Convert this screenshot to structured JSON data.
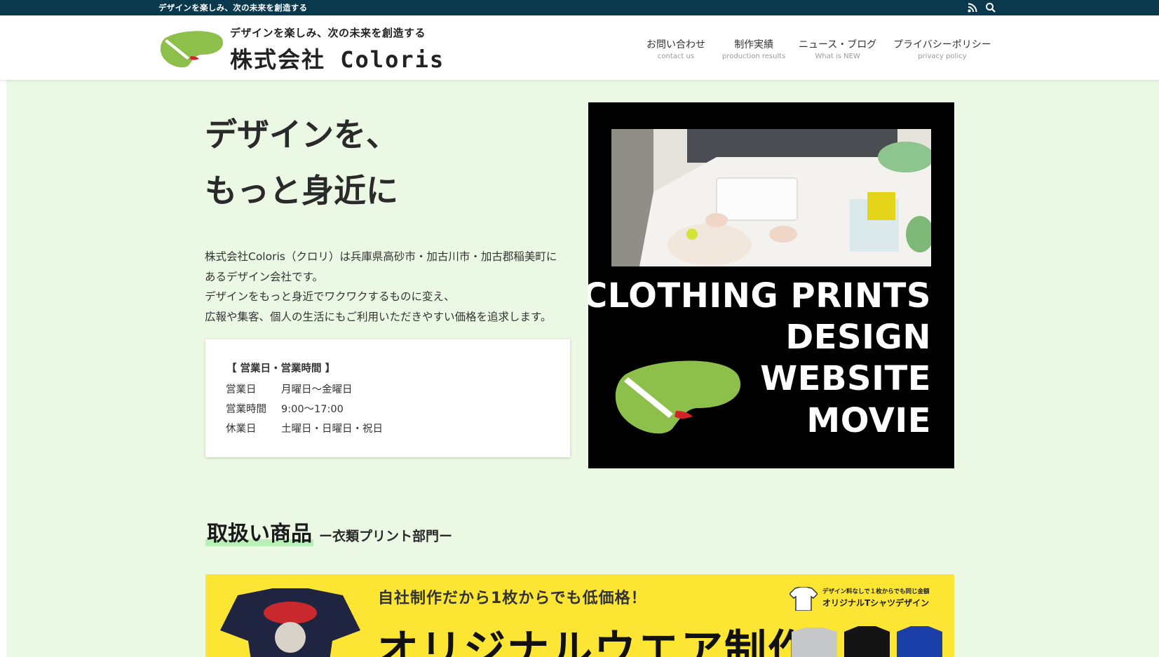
{
  "topbar": {
    "tagline": "デザインを楽しみ、次の未来を創造する",
    "rss_icon": "rss-icon",
    "search_icon": "search-icon"
  },
  "header": {
    "logo_sub": "デザインを楽しみ、次の未来を創造する",
    "logo_main": "株式会社 Coloris",
    "nav": [
      {
        "label": "お問い合わせ",
        "sub": "contact us"
      },
      {
        "label": "制作実績",
        "sub": "production results"
      },
      {
        "label": "ニュース・ブログ",
        "sub": "What is NEW"
      },
      {
        "label": "プライバシーポリシー",
        "sub": "privacy policy"
      }
    ]
  },
  "hero": {
    "title_line1": "デザインを、",
    "title_line2": "もっと身近に",
    "intro": [
      "株式会社Coloris（クロリ）は兵庫県高砂市・加古川市・加古郡稲美町に",
      "あるデザイン会社です。",
      "デザインをもっと身近でワクワクするものに変え、",
      "広報や集客、個人の生活にもご利用いただきやすい価格を追求します。"
    ]
  },
  "hours": {
    "title": "【 営業日・営業時間 】",
    "rows": [
      {
        "label": "営業日",
        "value": "月曜日〜金曜日"
      },
      {
        "label": "営業時間",
        "value": "9:00〜17:00"
      },
      {
        "label": "休業日",
        "value": "土曜日・日曜日・祝日"
      }
    ]
  },
  "banner": {
    "lines": [
      "CLOTHING PRINTS",
      "DESIGN",
      "WEBSITE",
      "MOVIE"
    ]
  },
  "products": {
    "title": "取扱い商品",
    "subtitle": "ー衣類プリント部門ー"
  },
  "promo": {
    "top": "自社制作だから1枚からでも低価格！",
    "big": "オリジナルウエア制作",
    "right_small": "デザイン料なしで１枚からでも同じ金額",
    "right_main": "オリジナルTシャツデザイン"
  },
  "colors": {
    "topbar": "#0a384d",
    "page_bg": "#ebf8e4",
    "brand_green": "#8cc04a",
    "promo_yellow": "#fde534"
  }
}
